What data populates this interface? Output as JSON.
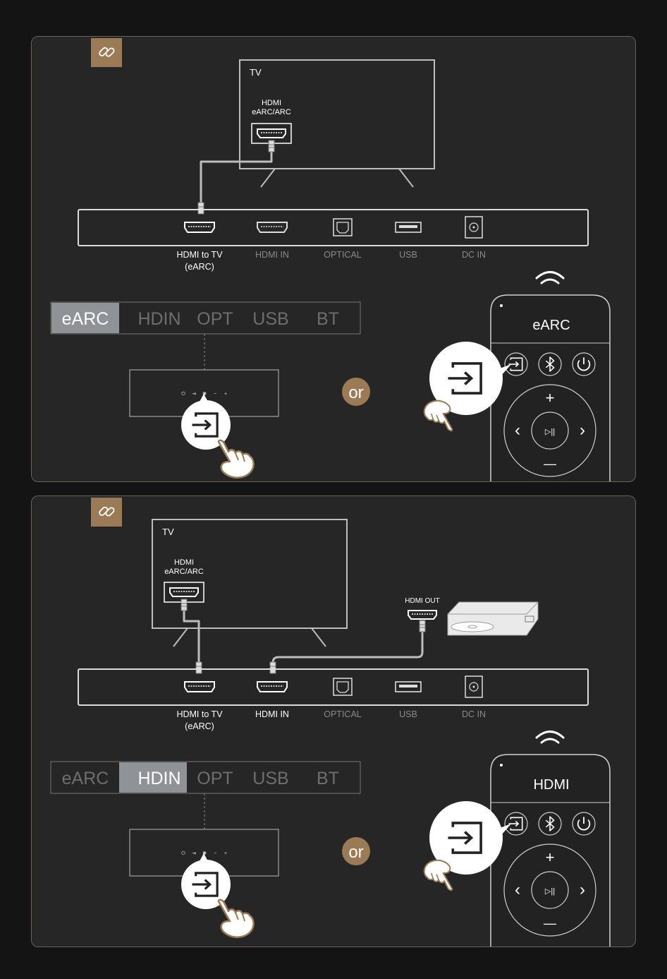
{
  "panels": [
    {
      "tv": {
        "label": "TV",
        "port_label_line1": "HDMI",
        "port_label_line2": "eARC/ARC"
      },
      "ports": [
        {
          "label": "HDMI to TV",
          "sub": "(eARC)",
          "active": true
        },
        {
          "label": "HDMI IN",
          "sub": "",
          "active": false
        },
        {
          "label": "OPTICAL",
          "sub": "",
          "active": false
        },
        {
          "label": "USB",
          "sub": "",
          "active": false
        },
        {
          "label": "DC IN",
          "sub": "",
          "active": false
        }
      ],
      "source_tabs": [
        {
          "label": "eARC",
          "selected": true
        },
        {
          "label": "HDIN",
          "selected": false
        },
        {
          "label": "OPT",
          "selected": false
        },
        {
          "label": "USB",
          "selected": false
        },
        {
          "label": "BT",
          "selected": false
        }
      ],
      "or_label": "or",
      "remote_display": "eARC",
      "player": null
    },
    {
      "tv": {
        "label": "TV",
        "port_label_line1": "HDMI",
        "port_label_line2": "eARC/ARC"
      },
      "ports": [
        {
          "label": "HDMI to TV",
          "sub": "(eARC)",
          "active": true
        },
        {
          "label": "HDMI IN",
          "sub": "",
          "active": true
        },
        {
          "label": "OPTICAL",
          "sub": "",
          "active": false
        },
        {
          "label": "USB",
          "sub": "",
          "active": false
        },
        {
          "label": "DC IN",
          "sub": "",
          "active": false
        }
      ],
      "source_tabs": [
        {
          "label": "eARC",
          "selected": false
        },
        {
          "label": "HDIN",
          "selected": true
        },
        {
          "label": "OPT",
          "selected": false
        },
        {
          "label": "USB",
          "selected": false
        },
        {
          "label": "BT",
          "selected": false
        }
      ],
      "or_label": "or",
      "remote_display": "HDMI",
      "player": {
        "port_label": "HDMI OUT"
      }
    }
  ],
  "colors": {
    "accent": "#9b7b56",
    "panel_bg": "#262626",
    "page_bg": "#141414",
    "active_text": "#ffffff",
    "inactive_text": "#8a8a8a",
    "tab_selected_bg": "#8f9398"
  },
  "icons": {
    "link_badge": "link-icon",
    "input": "input-source-icon",
    "bluetooth": "bluetooth-icon",
    "power": "power-icon",
    "wifi": "wireless-signal-icon",
    "hand": "pointing-hand-icon"
  }
}
